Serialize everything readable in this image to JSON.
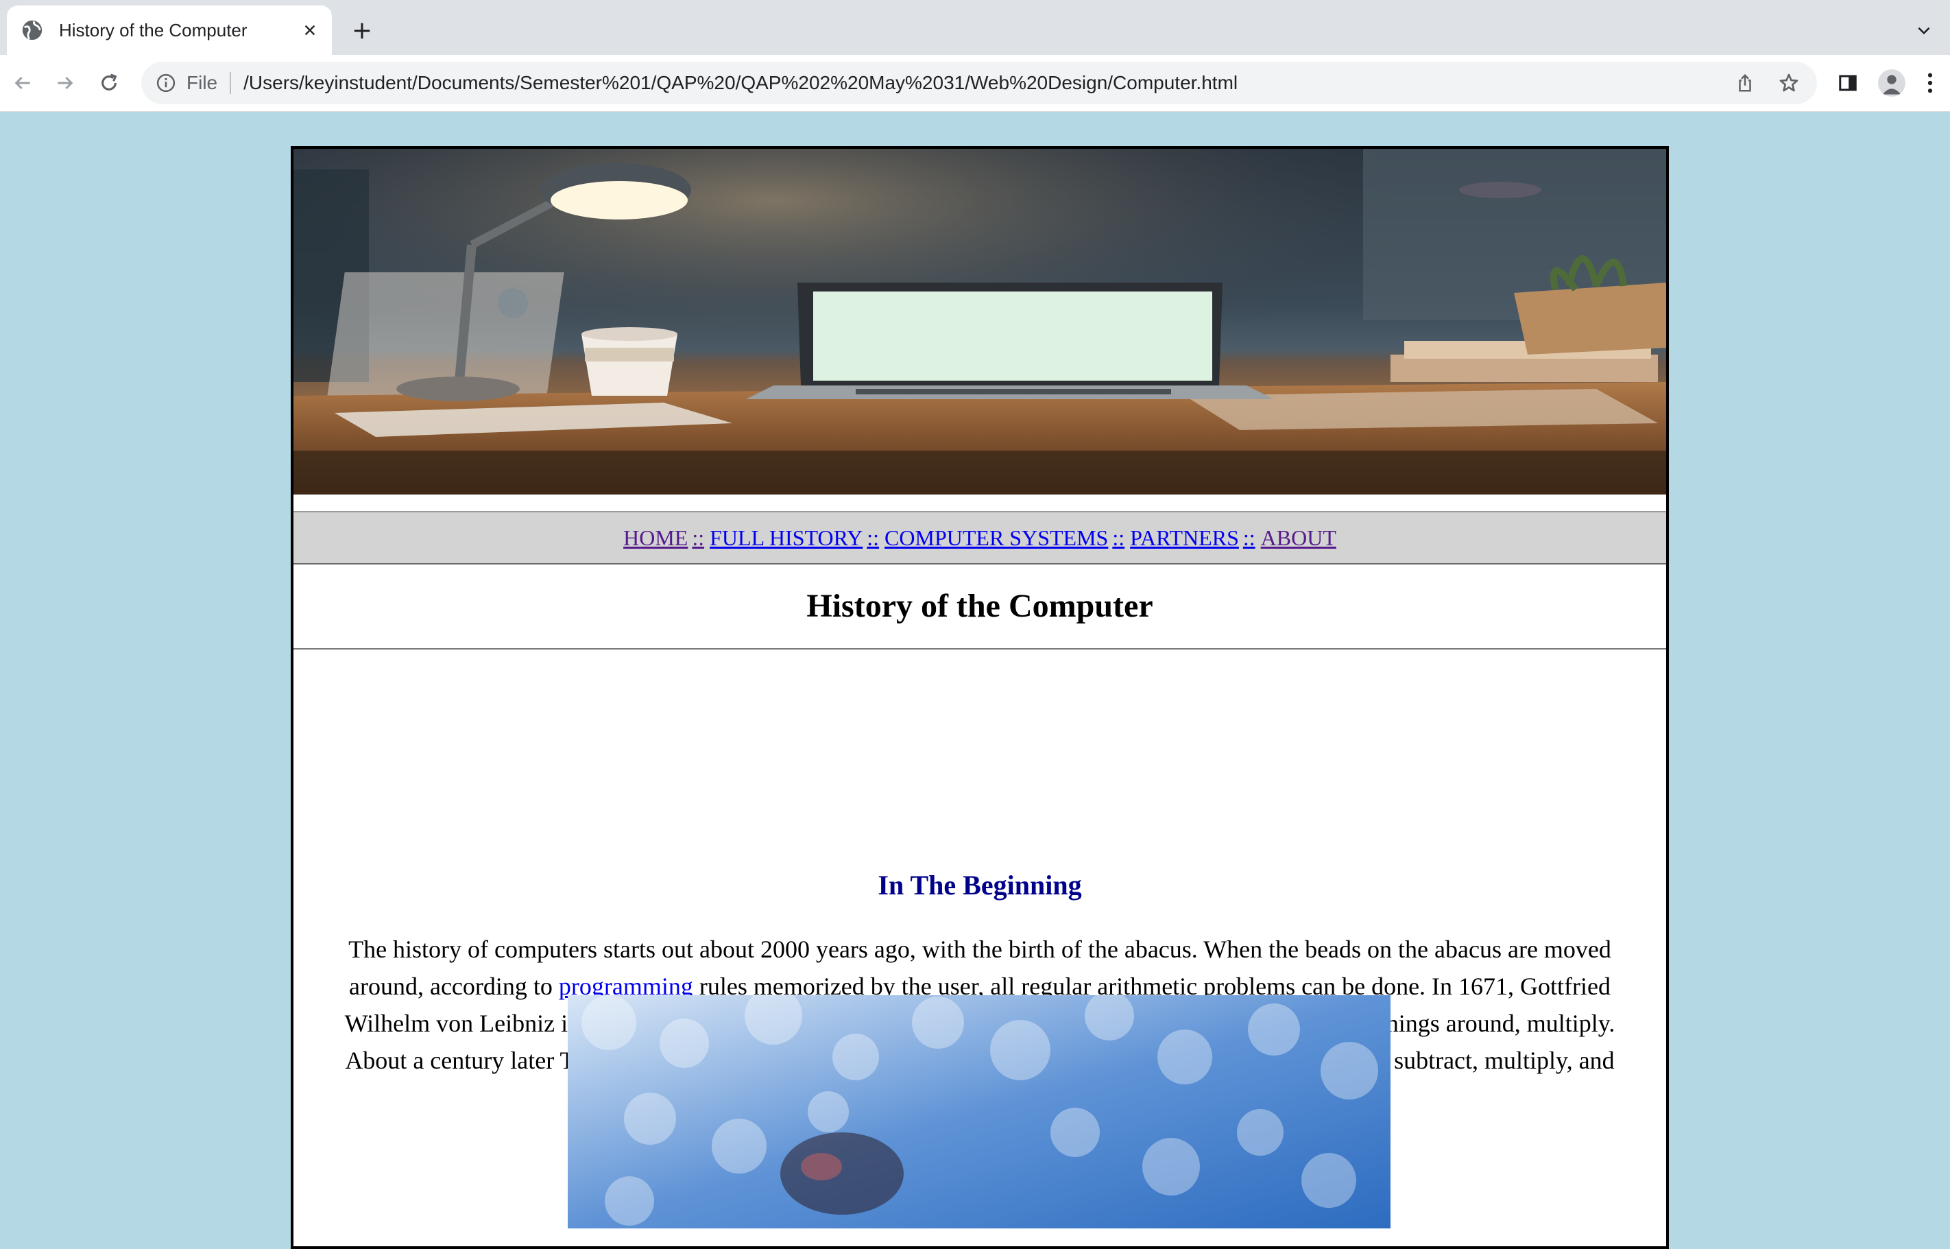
{
  "browser": {
    "tab_title": "History of the Computer",
    "url_scheme": "File",
    "url": "/Users/keyinstudent/Documents/Semester%201/QAP%20/QAP%202%20May%2031/Web%20Design/Computer.html"
  },
  "nav": {
    "items": [
      {
        "label": "HOME",
        "visited": true
      },
      {
        "label": "FULL HISTORY",
        "visited": false
      },
      {
        "label": "COMPUTER SYSTEMS",
        "visited": false
      },
      {
        "label": "PARTNERS",
        "visited": false
      },
      {
        "label": "ABOUT",
        "visited": true
      }
    ],
    "separator": "::"
  },
  "page": {
    "title": "History of the Computer",
    "section_title": "In The Beginning",
    "para_before_link": "The history of computers starts out about 2000 years ago, with the birth of the abacus. When the beads on the abacus are moved around, according to ",
    "para_link": "programming",
    "para_after_link": " rules memorized by the user, all regular arithmetic problems can be done. In 1671, Gottfried Wilhelm von Leibniz invented a computer that was built in 1694. It could add, and, after changing some things around, multiply. About a century later Thomas of Colmar created the first successful mechanical calculator that could add, subtract, multiply, and divide."
  },
  "colors": {
    "page_background": "#b5d8e5",
    "section_title": "#00008b",
    "link": "#0000ee",
    "visited_link": "#551a8b",
    "navbar_background": "#d3d3d3"
  }
}
